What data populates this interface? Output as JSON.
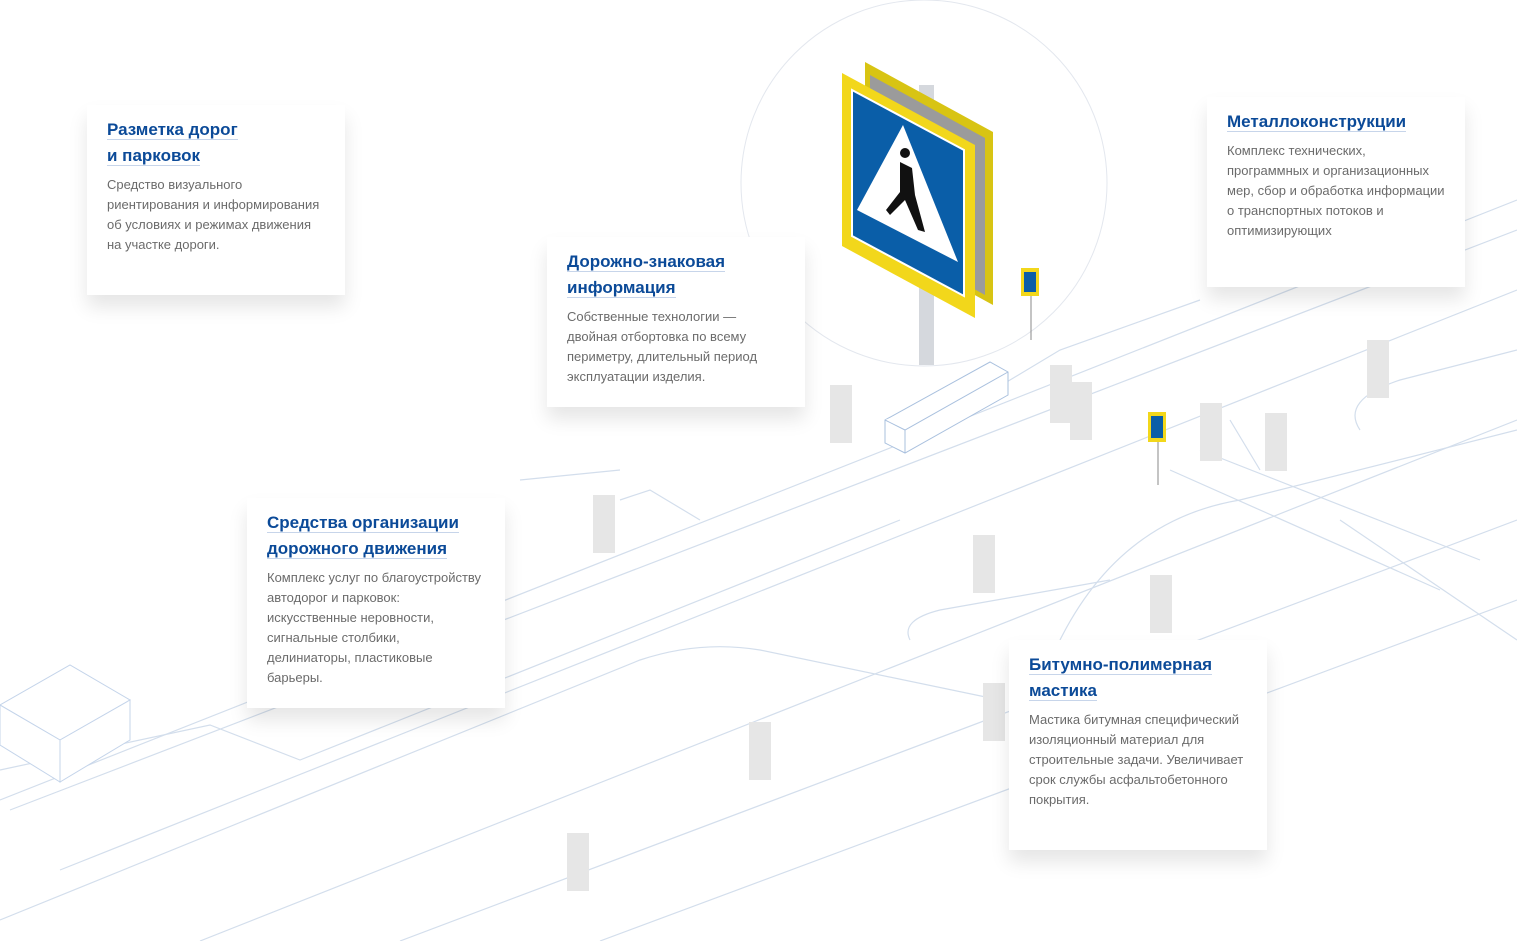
{
  "cards": [
    {
      "title_line1": "Разметка дорог",
      "title_line2": "и парковок",
      "text": "Средство визуального риентирования и информирования об условиях и режимах движения на участке дороги."
    },
    {
      "title_line1": "Дорожно-знаковая",
      "title_line2": "информация",
      "text": "Собственные технологии — двойная отбортовка по всему периметру, длительный период эксплуатации изделия."
    },
    {
      "title_line1": "Металлоконструкции",
      "title_line2": "",
      "text": "Комплекс технических, программных и организационных мер, сбор и обработка информации о транспортных потоков и оптимизирующих"
    },
    {
      "title_line1": "Средства организации",
      "title_line2": "дорожного движения",
      "text": "Комплекс услуг по благоустройству автодорог и парковок: искусственные неровности, сигнальные столбики, делиниаторы, пластиковые барьеры."
    },
    {
      "title_line1": "Битумно-полимерная",
      "title_line2": "мастика",
      "text": "Мастика битумная специфический изоляционный материал для строительные задачи. Увеличивает срок службы асфальтобетонного покрытия."
    }
  ],
  "colors": {
    "title": "#0b4a98",
    "sign_blue": "#0a5ea8",
    "sign_yellow": "#f2d71b",
    "lines": "#c9d6e8"
  }
}
